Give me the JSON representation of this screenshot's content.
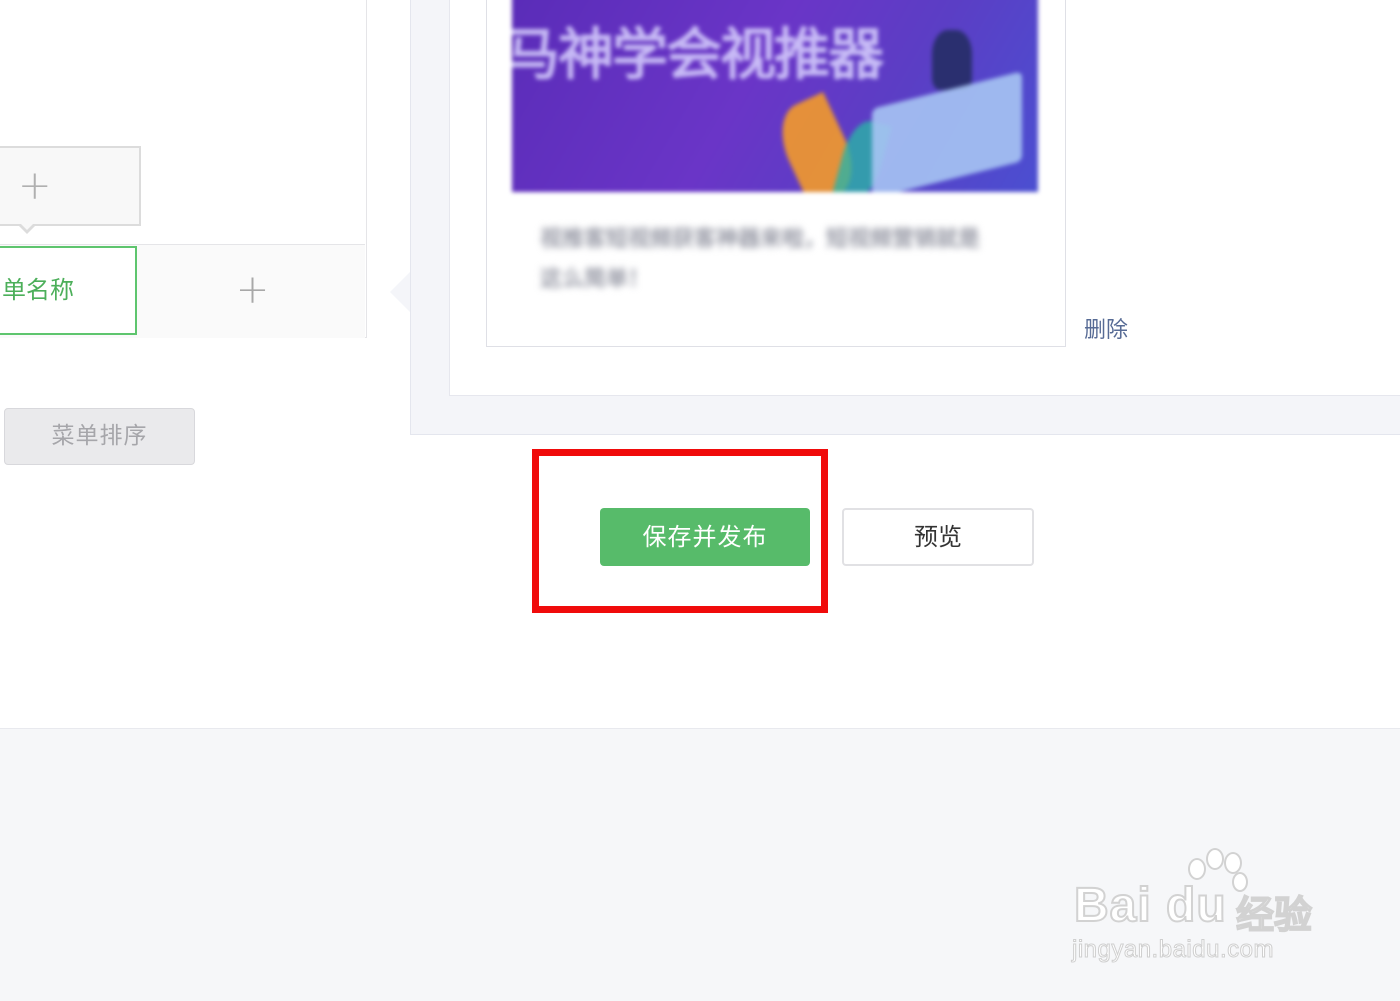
{
  "menu_editor": {
    "submenu_add_icon": "plus-icon",
    "active_menu_label": "单名称",
    "menu_add_icon": "plus-icon",
    "sort_button_label": "菜单排序"
  },
  "article": {
    "cover_title": "马神学会视推器",
    "cover_image": "purple-cover-illustration",
    "description": "视推客短视频获客神器来啦，短视频营销就是这么简单！",
    "delete_label": "删除"
  },
  "actions": {
    "save_publish_label": "保存并发布",
    "preview_label": "预览",
    "highlight_color": "#f00b0b",
    "primary_color": "#57bb6a"
  },
  "watermark": {
    "brand": "Bai du",
    "brand_cn": "经验",
    "url": "jingyan.baidu.com"
  }
}
